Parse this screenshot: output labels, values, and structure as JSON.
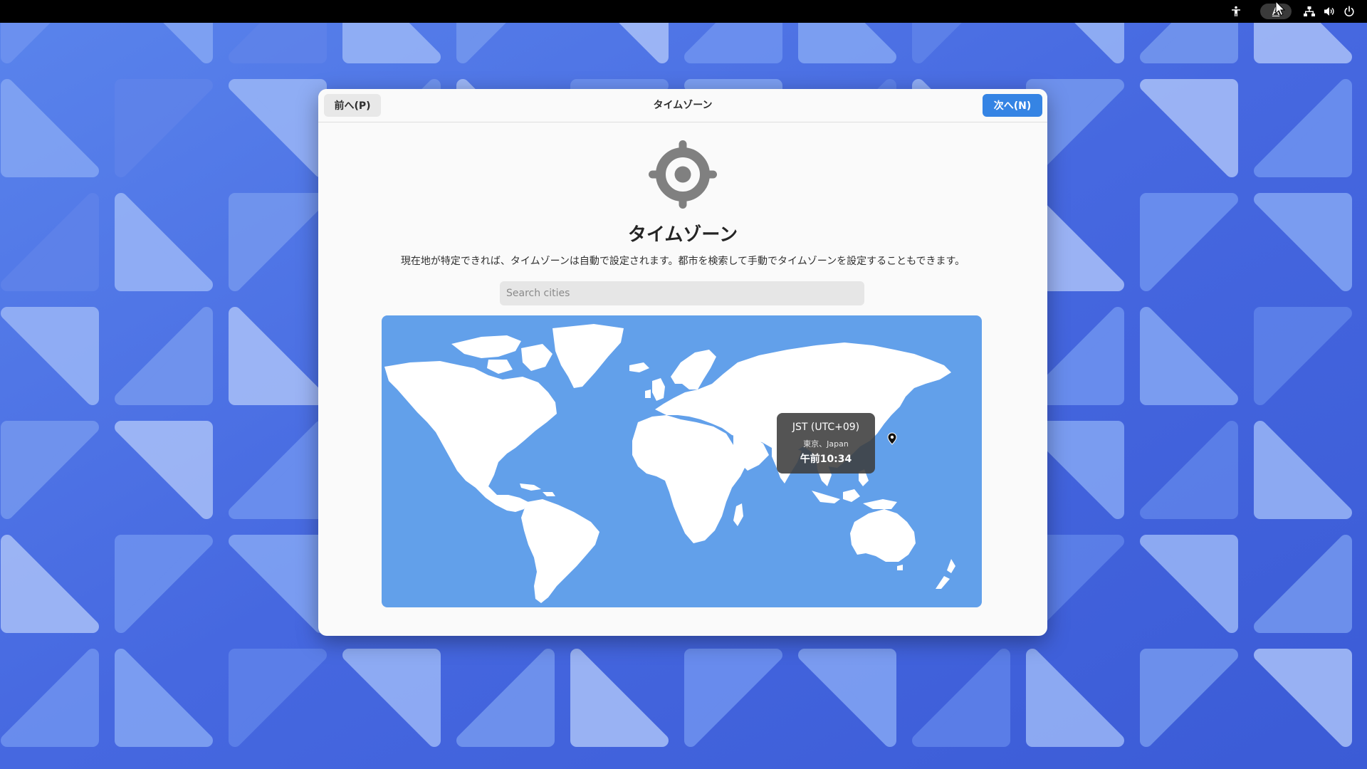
{
  "topbar": {
    "ime_label": "A",
    "icons": [
      "accessibility-icon",
      "input-method-icon",
      "network-icon",
      "volume-icon",
      "power-icon"
    ]
  },
  "dialog": {
    "header": {
      "back_label": "前へ(P)",
      "title": "タイムゾーン",
      "next_label": "次へ(N)"
    },
    "heading": "タイムゾーン",
    "description": "現在地が特定できれば、タイムゾーンは自動で設定されます。都市を検索して手動でタイムゾーンを設定することもできます。",
    "search": {
      "placeholder": "Search cities",
      "value": ""
    },
    "map": {
      "popup": {
        "timezone": "JST (UTC+09)",
        "city": "東京、Japan",
        "time": "午前10:34"
      }
    }
  },
  "colors": {
    "accent": "#3584e4",
    "ocean": "#62a0ea",
    "land": "#ffffff",
    "wallpaper": "#4a6fe0"
  }
}
